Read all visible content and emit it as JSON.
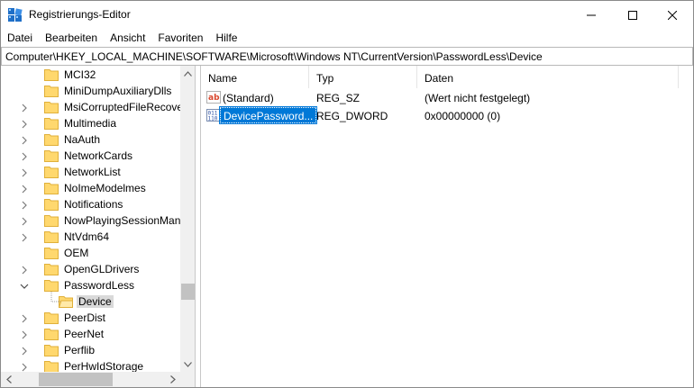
{
  "window": {
    "title": "Registrierungs-Editor"
  },
  "menu": [
    "Datei",
    "Bearbeiten",
    "Ansicht",
    "Favoriten",
    "Hilfe"
  ],
  "address": "Computer\\HKEY_LOCAL_MACHINE\\SOFTWARE\\Microsoft\\Windows NT\\CurrentVersion\\PasswordLess\\Device",
  "tree": {
    "items": [
      {
        "label": "MCI32",
        "expandable": false,
        "expanded": false,
        "selected": false,
        "depth": 0
      },
      {
        "label": "MiniDumpAuxiliaryDlls",
        "expandable": false,
        "expanded": false,
        "selected": false,
        "depth": 0
      },
      {
        "label": "MsiCorruptedFileRecove",
        "expandable": true,
        "expanded": false,
        "selected": false,
        "depth": 0
      },
      {
        "label": "Multimedia",
        "expandable": true,
        "expanded": false,
        "selected": false,
        "depth": 0
      },
      {
        "label": "NaAuth",
        "expandable": true,
        "expanded": false,
        "selected": false,
        "depth": 0
      },
      {
        "label": "NetworkCards",
        "expandable": true,
        "expanded": false,
        "selected": false,
        "depth": 0
      },
      {
        "label": "NetworkList",
        "expandable": true,
        "expanded": false,
        "selected": false,
        "depth": 0
      },
      {
        "label": "NoImeModelmes",
        "expandable": true,
        "expanded": false,
        "selected": false,
        "depth": 0
      },
      {
        "label": "Notifications",
        "expandable": true,
        "expanded": false,
        "selected": false,
        "depth": 0
      },
      {
        "label": "NowPlayingSessionMana",
        "expandable": true,
        "expanded": false,
        "selected": false,
        "depth": 0
      },
      {
        "label": "NtVdm64",
        "expandable": true,
        "expanded": false,
        "selected": false,
        "depth": 0
      },
      {
        "label": "OEM",
        "expandable": false,
        "expanded": false,
        "selected": false,
        "depth": 0
      },
      {
        "label": "OpenGLDrivers",
        "expandable": true,
        "expanded": false,
        "selected": false,
        "depth": 0
      },
      {
        "label": "PasswordLess",
        "expandable": true,
        "expanded": true,
        "selected": false,
        "depth": 0
      },
      {
        "label": "Device",
        "expandable": false,
        "expanded": false,
        "selected": true,
        "depth": 1
      },
      {
        "label": "PeerDist",
        "expandable": true,
        "expanded": false,
        "selected": false,
        "depth": 0
      },
      {
        "label": "PeerNet",
        "expandable": true,
        "expanded": false,
        "selected": false,
        "depth": 0
      },
      {
        "label": "Perflib",
        "expandable": true,
        "expanded": false,
        "selected": false,
        "depth": 0
      },
      {
        "label": "PerHwIdStorage",
        "expandable": true,
        "expanded": false,
        "selected": false,
        "depth": 0
      }
    ],
    "vscroll_position": 0.78,
    "hscroll_position": 0.3
  },
  "values": {
    "columns": [
      "Name",
      "Typ",
      "Daten"
    ],
    "rows": [
      {
        "icon": "string-value-icon",
        "name": "(Standard)",
        "type": "REG_SZ",
        "data": "(Wert nicht festgelegt)",
        "selected": false
      },
      {
        "icon": "binary-value-icon",
        "name": "DevicePassword...",
        "type": "REG_DWORD",
        "data": "0x00000000 (0)",
        "selected": true
      }
    ]
  },
  "colors": {
    "selection": "#0078d7",
    "tree_selection": "#d9d9d9",
    "folder": "#ffd86e",
    "folder_dark": "#e0b03a",
    "scroll_thumb": "#c2c2c2"
  }
}
